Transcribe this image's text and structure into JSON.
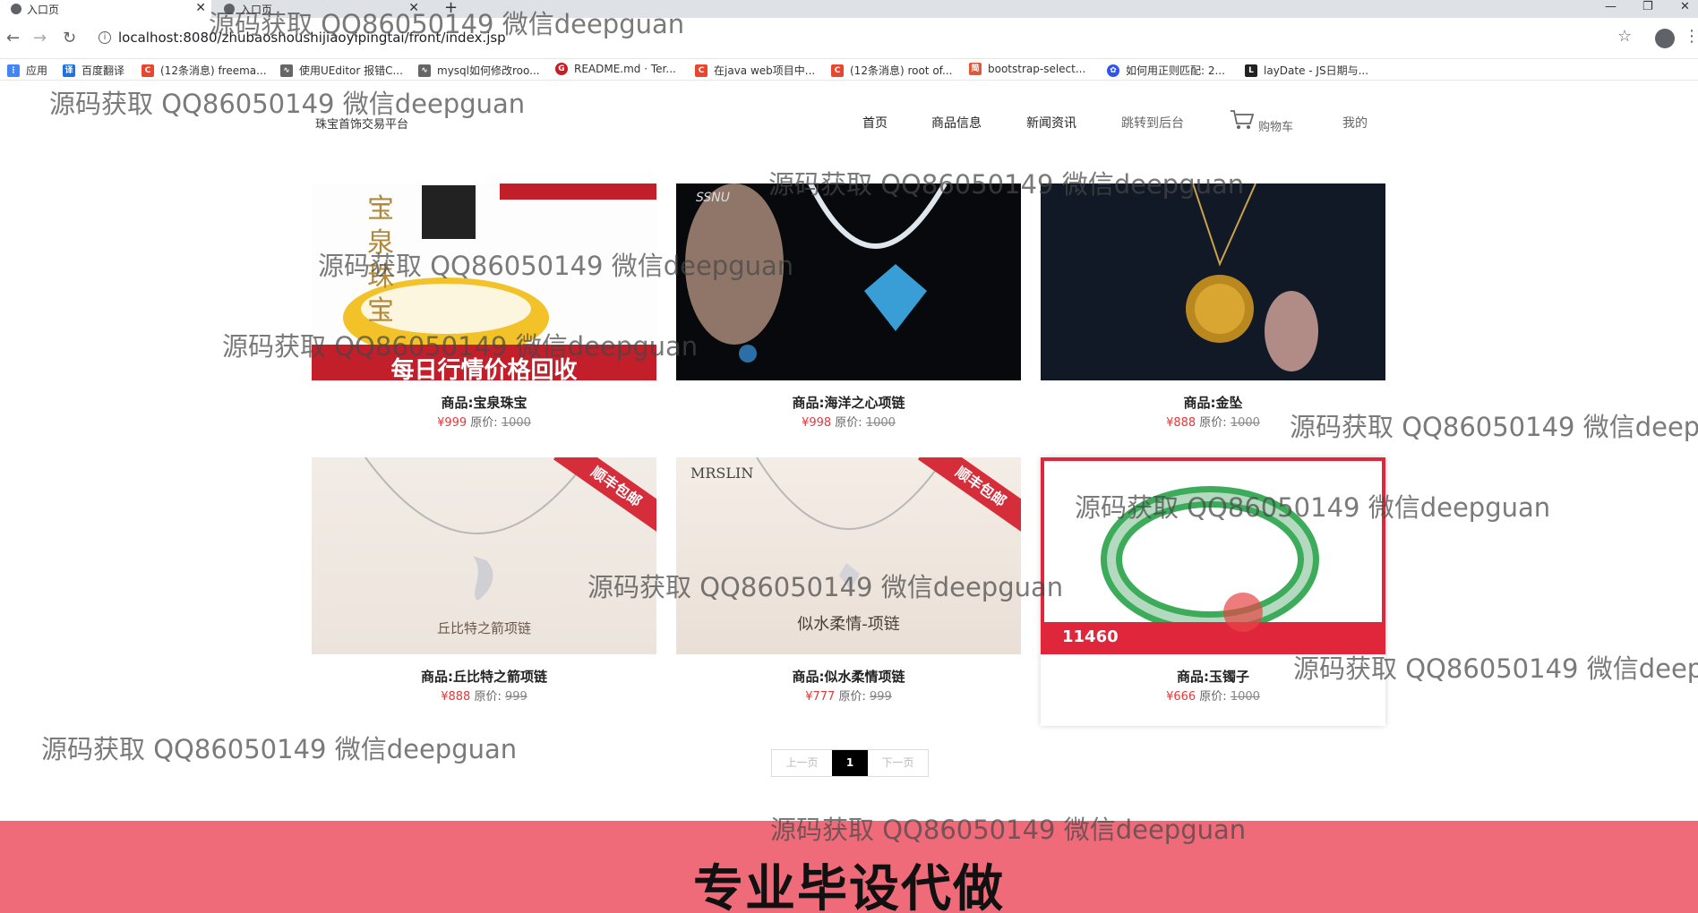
{
  "browser": {
    "tabs": [
      {
        "title": "入口页",
        "active": true
      },
      {
        "title": "入口页",
        "active": false
      }
    ],
    "url": "localhost:8080/zhubaoshoushijiaoyipingtai/front/index.jsp",
    "bookmarks": [
      {
        "label": "应用",
        "icon": "apps-icon"
      },
      {
        "label": "百度翻译",
        "icon": "translate-icon"
      },
      {
        "label": "(12条消息) freema...",
        "icon": "csdn-icon"
      },
      {
        "label": "使用UEditor 报错C...",
        "icon": "link-icon"
      },
      {
        "label": "mysql如何修改roo...",
        "icon": "link-icon"
      },
      {
        "label": "README.md · Ter...",
        "icon": "gitee-icon"
      },
      {
        "label": "在java web项目中...",
        "icon": "csdn-icon"
      },
      {
        "label": "(12条消息) root of...",
        "icon": "csdn-icon"
      },
      {
        "label": "bootstrap-select...",
        "icon": "bookmark-icon"
      },
      {
        "label": "如何用正则匹配: 2...",
        "icon": "baidu-icon"
      },
      {
        "label": "layDate - JS日期与...",
        "icon": "laydate-icon"
      }
    ]
  },
  "site": {
    "title": "珠宝首饰交易平台",
    "nav": [
      "首页",
      "商品信息",
      "新闻资讯",
      "跳转到后台",
      "购物车",
      "我的"
    ]
  },
  "products": [
    {
      "name": "商品:宝泉珠宝",
      "price": "¥999",
      "orig_label": "原价:",
      "orig": "1000",
      "img_text": "每日行情价格回收"
    },
    {
      "name": "商品:海洋之心项链",
      "price": "¥998",
      "orig_label": "原价:",
      "orig": "1000",
      "img_text": "SSNU"
    },
    {
      "name": "商品:金坠",
      "price": "¥888",
      "orig_label": "原价:",
      "orig": "1000",
      "img_text": ""
    },
    {
      "name": "商品:丘比特之箭项链",
      "price": "¥888",
      "orig_label": "原价:",
      "orig": "999",
      "img_text": "丘比特之箭项链"
    },
    {
      "name": "商品:似水柔情项链",
      "price": "¥777",
      "orig_label": "原价:",
      "orig": "999",
      "img_text": "似水柔情-项链"
    },
    {
      "name": "商品:玉镯子",
      "price": "¥666",
      "orig_label": "原价:",
      "orig": "1000",
      "img_text": "11460"
    }
  ],
  "pagination": {
    "prev": "上一页",
    "current": "1",
    "next": "下一页"
  },
  "watermark": "源码获取 QQ86050149 微信deepguan",
  "bottom_banner": "专业毕设代做",
  "colors": {
    "price": "#e4393c",
    "banner": "#f06b7a"
  }
}
